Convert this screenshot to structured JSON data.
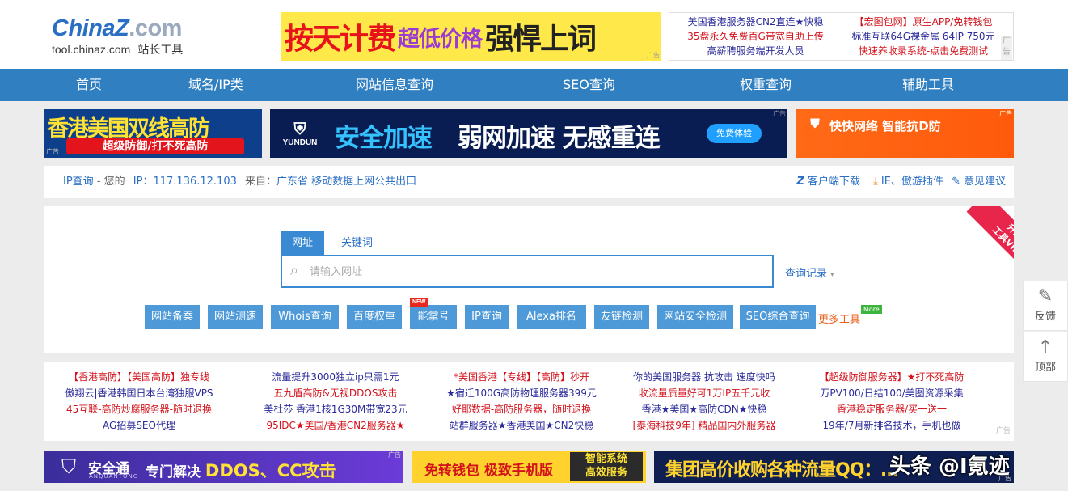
{
  "header": {
    "logo_main": "ChinaZ",
    "logo_suffix": ".com",
    "logo_domain": "tool.chinaz.com",
    "logo_tag": "站长工具",
    "ad_main": {
      "part1": "按天计费",
      "part2": "超低价格",
      "part3": "强悍上词"
    },
    "ad_label": "广告",
    "text_ads": [
      "美国香港服务器CN2直连★快稳",
      "【宏图包网】原生APP/免转钱包",
      "35盘永久免费百G带宽自助上传",
      "标准互联64G裸金属 64IP 750元",
      "高薪聘服务端开发人员",
      "快速养收录系统-点击免费测试"
    ],
    "text_ad_colors": [
      "#2a2a9a",
      "#d3121b",
      "#d3121b",
      "#2a2a9a",
      "#2a2a9a",
      "#d3121b"
    ]
  },
  "nav": {
    "items": [
      "首页",
      "域名/IP类",
      "网站信息查询",
      "SEO查询",
      "权重查询",
      "辅助工具"
    ]
  },
  "banners": {
    "b1": {
      "title": "香港美国双线高防",
      "sub": "超级防御/打不死高防"
    },
    "b2": {
      "brand": "YUNDUN",
      "s1": "安全加速",
      "s2": "弱网加速 无感重连",
      "btn": "免费体验"
    },
    "b3": {
      "text": "快快网络 智能抗D防"
    }
  },
  "infobar": {
    "ip_query": "IP查询",
    "yours": "- 您的",
    "ip_label": "IP：",
    "ip": "117.136.12.103",
    "from_label": "来自：",
    "location": "广东省 移动数据上网公共出口",
    "client_download": "客户端下载",
    "plugins": "IE、傲游插件",
    "feedback": "意见建议"
  },
  "search": {
    "tab_active": "网址",
    "tab_inactive": "关键词",
    "placeholder": "请输入网址",
    "history": "查询记录",
    "vip": "升级\n工具VIP",
    "new_badge": "NEW",
    "quick_buttons": [
      "网站备案",
      "网站测速",
      "Whois查询",
      "百度权重",
      "能掌号",
      "IP查询",
      "Alexa排名",
      "友链检测",
      "网站安全检测",
      "SEO综合查询"
    ],
    "more": "更多工具",
    "more_badge": "More"
  },
  "text_ads2": [
    [
      "【香港高防】【美国高防】独专线",
      "傲翔云|香港韩国日本台湾独服VPS",
      "45互联-高防炒腐服务器-随时退换",
      "AG招募SEO代理"
    ],
    [
      "流量提升3000独立ip只需1元",
      "五九盾高防&无视DDOS攻击",
      "美杜莎 香港1核1G30M带宽23元",
      "95IDC★美国/香港CN2服务器★"
    ],
    [
      "*美国香港【专线】【高防】秒开",
      "★宿迁100G高防物理服务器399元",
      "好耶数据-高防服务器，随时退换",
      "站群服务器★香港美国★CN2快稳"
    ],
    [
      "你的美国服务器 抗攻击 速度快吗",
      "收流量质量好可1万IP五千元收",
      "香港★美国★高防CDN★快稳",
      "[泰海科技9年] 精品国内外服务器"
    ],
    [
      "【超级防御服务器】★打不死高防",
      "万PV100/日结100/美图资源采集",
      "香港稳定服务器/买一送一",
      "19年/7月新排名技术，手机也做"
    ]
  ],
  "text_ads2_colors": [
    [
      "#d3121b",
      "#2a2a9a",
      "#d3121b",
      "#2a2a9a"
    ],
    [
      "#2a2a9a",
      "#d3121b",
      "#2a2a9a",
      "#d3121b"
    ],
    [
      "#d3121b",
      "#2a2a9a",
      "#d3121b",
      "#2a2a9a"
    ],
    [
      "#2a2a9a",
      "#d3121b",
      "#2a2a9a",
      "#d3121b"
    ],
    [
      "#d3121b",
      "#2a2a9a",
      "#d3121b",
      "#2a2a9a"
    ]
  ],
  "bottom_ads": {
    "bt1": {
      "brand": "安全通",
      "sub": "ANQUANTONG",
      "text1": "专门解决",
      "text2": "DDOS、CC攻击"
    },
    "bt2": {
      "text": "免转钱包 极致手机版",
      "box": "智能系统\n高效服务"
    },
    "bt3": {
      "text": "集团高价收购各种流量QQ：…"
    }
  },
  "watermark": "头条 @I氪迹",
  "side": {
    "feedback": "反馈",
    "top": "顶部"
  },
  "colors": {
    "nav": "#2f7fc1",
    "accent": "#3a8ad3",
    "link": "#2a6fc4",
    "orange": "#e8601c"
  }
}
